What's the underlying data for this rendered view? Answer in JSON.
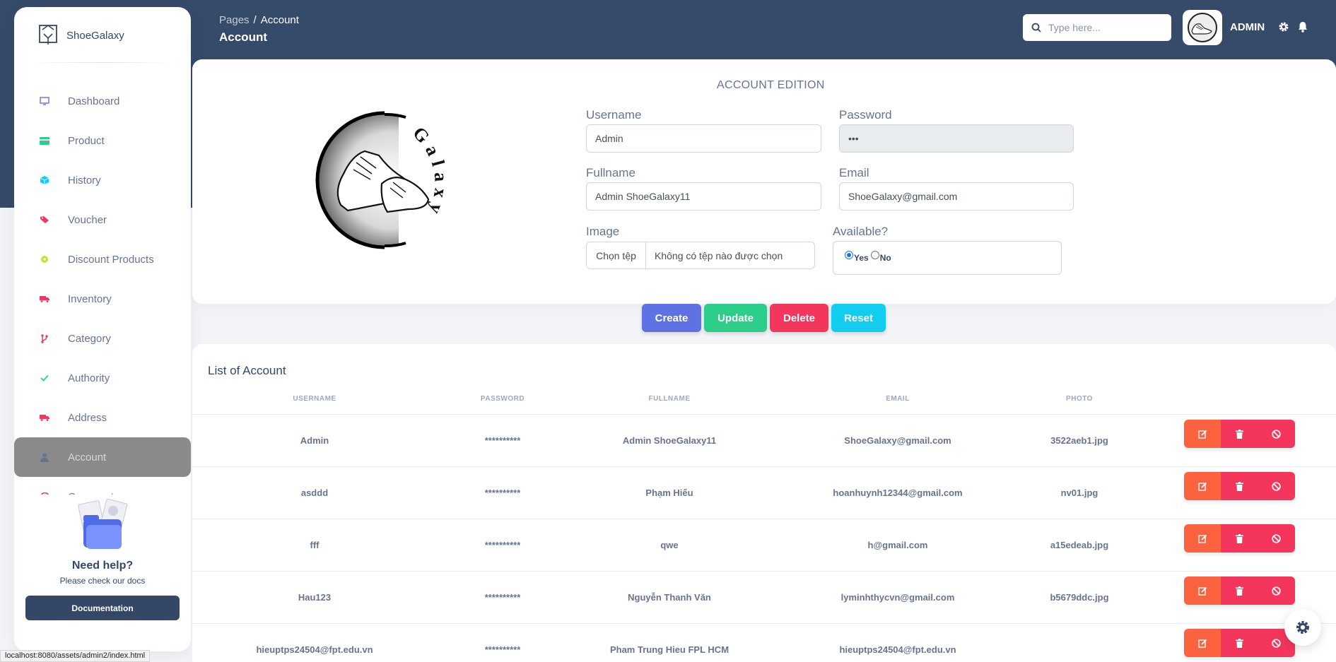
{
  "brand": {
    "name": "ShoeGalaxy"
  },
  "sidebar": {
    "items": [
      {
        "label": "Dashboard",
        "icon": "monitor-icon",
        "color": "#5e72e4"
      },
      {
        "label": "Product",
        "icon": "card-icon",
        "color": "#2dce89"
      },
      {
        "label": "History",
        "icon": "cube-icon",
        "color": "#11cdef"
      },
      {
        "label": "Voucher",
        "icon": "tag-icon",
        "color": "#f5365c"
      },
      {
        "label": "Discount Products",
        "icon": "circle-icon",
        "color": "#c6e13b"
      },
      {
        "label": "Inventory",
        "icon": "truck-icon",
        "color": "#f5365c"
      },
      {
        "label": "Category",
        "icon": "branch-icon",
        "color": "#f5365c"
      },
      {
        "label": "Authority",
        "icon": "check-icon",
        "color": "#2dce89"
      },
      {
        "label": "Address",
        "icon": "truck-icon",
        "color": "#f5365c"
      },
      {
        "label": "Account",
        "icon": "user-icon",
        "color": "#67748e"
      },
      {
        "label": "Comments",
        "icon": "chat-icon",
        "color": "#f5365c"
      }
    ],
    "active": "Account",
    "help": {
      "title": "Need help?",
      "subtitle": "Please check our docs",
      "button": "Documentation"
    }
  },
  "status_bar": "localhost:8080/assets/admin2/index.html",
  "header": {
    "breadcrumb_parent": "Pages",
    "breadcrumb_current": "Account",
    "title": "Account",
    "search_placeholder": "Type here...",
    "user": "ADMIN"
  },
  "form": {
    "heading": "ACCOUNT EDITION",
    "logo_text": "Galaxy",
    "username_label": "Username",
    "username_value": "Admin",
    "password_label": "Password",
    "password_value": "•••",
    "fullname_label": "Fullname",
    "fullname_value": "Admin ShoeGalaxy11",
    "email_label": "Email",
    "email_value": "ShoeGalaxy@gmail.com",
    "image_label": "Image",
    "file_button": "Chọn tệp",
    "file_name": "Không có tệp nào được chọn",
    "available_label": "Available?",
    "yes_label": "Yes",
    "no_label": "No",
    "available_selected": "Yes"
  },
  "actions": [
    {
      "label": "Create",
      "color": "#5e72e4"
    },
    {
      "label": "Update",
      "color": "#2dce89"
    },
    {
      "label": "Delete",
      "color": "#f5365c"
    },
    {
      "label": "Reset",
      "color": "#11cdef"
    }
  ],
  "table": {
    "title": "List of Account",
    "columns": [
      "USERNAME",
      "PASSWORD",
      "FULLNAME",
      "EMAIL",
      "PHOTO"
    ],
    "rows": [
      [
        "Admin",
        "**********",
        "Admin ShoeGalaxy11",
        "ShoeGalaxy@gmail.com",
        "3522aeb1.jpg"
      ],
      [
        "asddd",
        "**********",
        "Phạm Hiếu",
        "hoanhuynh12344@gmail.com",
        "nv01.jpg"
      ],
      [
        "fff",
        "**********",
        "qwe",
        "h@gmail.com",
        "a15edeab.jpg"
      ],
      [
        "Hau123",
        "**********",
        "Nguyễn Thanh Văn",
        "lyminhthycvn@gmail.com",
        "b5679ddc.jpg"
      ],
      [
        "hieuptps24504@fpt.edu.vn",
        "**********",
        "Pham Trung Hieu FPL HCM",
        "hieuptps24504@fpt.edu.vn",
        ""
      ]
    ]
  }
}
